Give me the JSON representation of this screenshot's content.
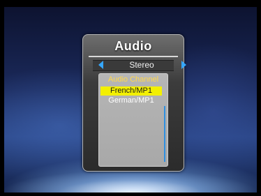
{
  "colors": {
    "accent_blue": "#35a7ff",
    "highlight_yellow": "#f3f000",
    "header_yellow": "#ffd84a"
  },
  "dialog": {
    "title": "Audio",
    "mode_value": "Stereo",
    "left_arrow_icon": "triangle-left-icon",
    "right_arrow_icon": "triangle-right-icon",
    "channel_list": {
      "header": "Audio Channel",
      "items": [
        {
          "label": "French/MP1",
          "selected": true
        },
        {
          "label": "German/MP1",
          "selected": false
        }
      ]
    }
  }
}
